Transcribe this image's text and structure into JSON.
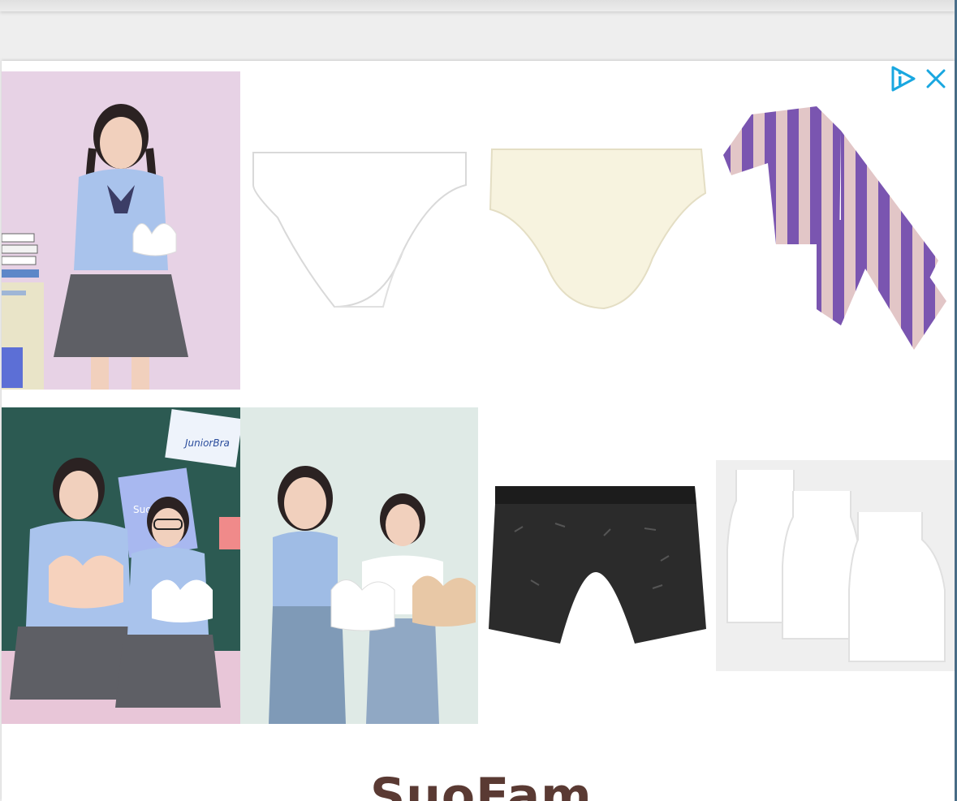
{
  "ad": {
    "choices_icon": "adchoices-icon",
    "close_icon": "close-icon",
    "accent_color": "#19a7e0",
    "brand_color": "#5a3a33"
  },
  "products": [
    {
      "type": "lifestyle-photo",
      "icon": "girl-holding-bra-photo"
    },
    {
      "type": "product",
      "icon": "white-briefs-icon"
    },
    {
      "type": "product",
      "icon": "ivory-briefs-icon"
    },
    {
      "type": "product",
      "icon": "purple-striped-pajamas-icon"
    },
    {
      "type": "lifestyle-photo",
      "icon": "classroom-girls-bras-photo",
      "sign_text": "JuniorBra",
      "poster_text": "SuoFam"
    },
    {
      "type": "lifestyle-photo",
      "icon": "girls-holding-bras-photo"
    },
    {
      "type": "product",
      "icon": "black-boxer-briefs-icon"
    },
    {
      "type": "product",
      "icon": "white-camisoles-icon"
    }
  ],
  "brand": {
    "logo_text": "SuoFam"
  }
}
